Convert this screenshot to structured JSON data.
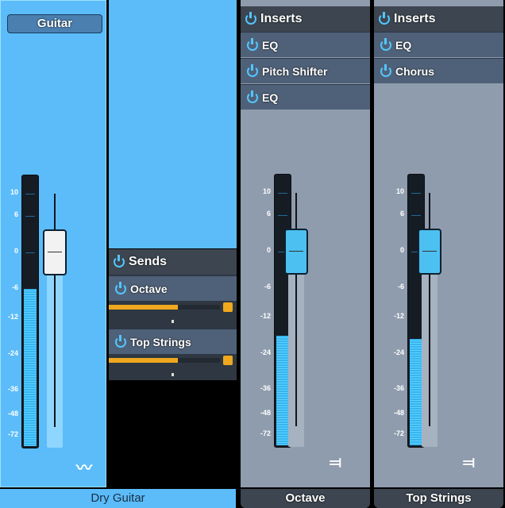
{
  "colors": {
    "selected_channel": "#5bbcf9",
    "channel": "#8f9cad",
    "meter": "#36b6f0",
    "send_level": "#f0a81e"
  },
  "scale": [
    "10",
    "6",
    "0",
    "-6",
    "-12",
    "-24",
    "-36",
    "-48",
    "-72"
  ],
  "channels": [
    {
      "name": "Dry Guitar",
      "input_label": "Guitar",
      "meter_level_db": -6,
      "fader_db": 0,
      "icon": "waveform-icon"
    },
    {
      "name": "Octave",
      "meter_level_db": -18,
      "fader_db": 0,
      "icon": "output-routing-icon",
      "inserts": {
        "header": "Inserts",
        "items": [
          "EQ",
          "Pitch Shifter",
          "EQ"
        ]
      }
    },
    {
      "name": "Top Strings",
      "meter_level_db": -19,
      "fader_db": 0,
      "icon": "output-routing-icon",
      "inserts": {
        "header": "Inserts",
        "items": [
          "EQ",
          "Chorus"
        ]
      }
    }
  ],
  "sends": {
    "header": "Sends",
    "items": [
      {
        "name": "Octave",
        "level_percent": 62,
        "pan": "center"
      },
      {
        "name": "Top Strings",
        "level_percent": 62,
        "pan": "center"
      }
    ]
  }
}
